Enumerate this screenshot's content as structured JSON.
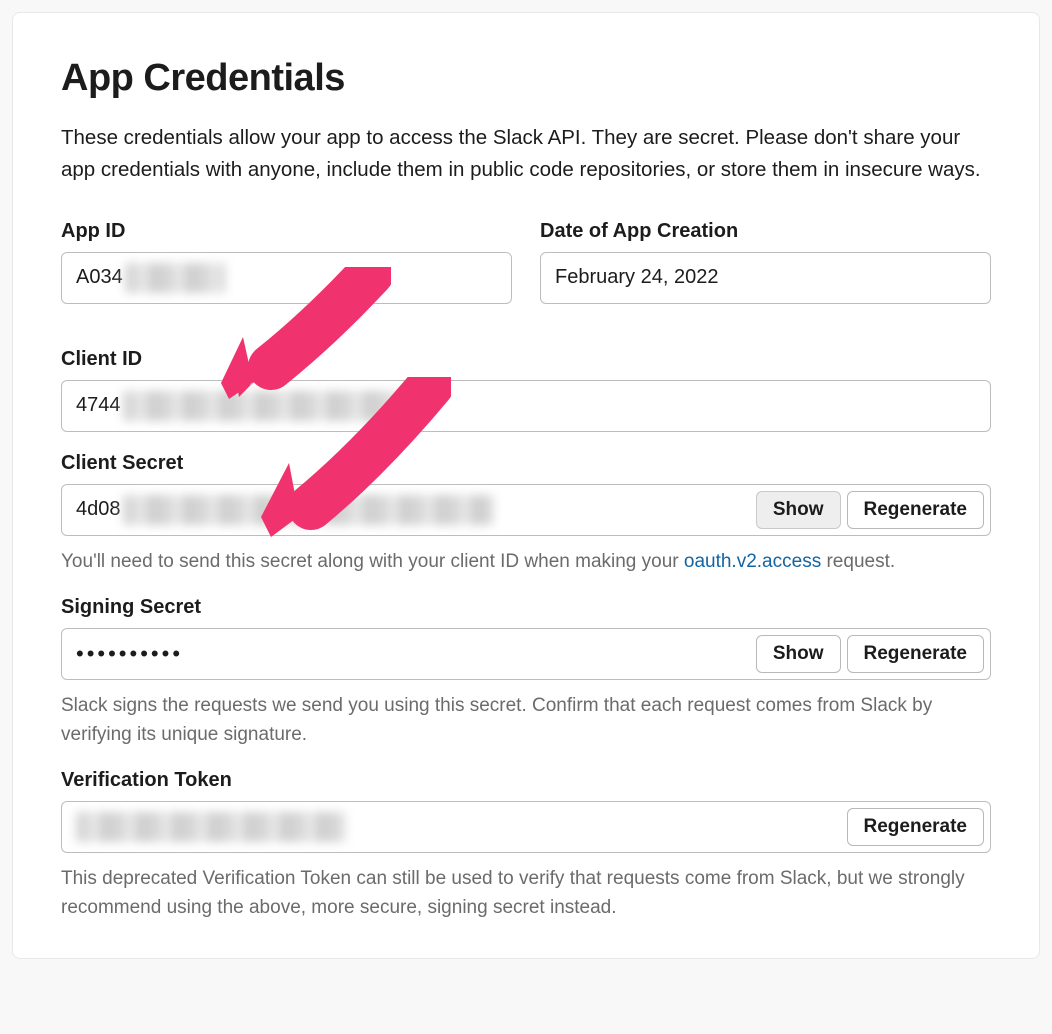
{
  "header": {
    "title": "App Credentials",
    "intro": "These credentials allow your app to access the Slack API. They are secret. Please don't share your app credentials with anyone, include them in public code repositories, or store them in insecure ways."
  },
  "fields": {
    "app_id": {
      "label": "App ID",
      "value_prefix": "A034"
    },
    "creation_date": {
      "label": "Date of App Creation",
      "value": "February 24, 2022"
    },
    "client_id": {
      "label": "Client ID",
      "value_prefix": "4744"
    },
    "client_secret": {
      "label": "Client Secret",
      "value_prefix": "4d08",
      "show_label": "Show",
      "regenerate_label": "Regenerate",
      "help_pre": "You'll need to send this secret along with your client ID when making your ",
      "help_link_text": "oauth.v2.access",
      "help_post": " request."
    },
    "signing_secret": {
      "label": "Signing Secret",
      "masked_value": "••••••••••",
      "show_label": "Show",
      "regenerate_label": "Regenerate",
      "help": "Slack signs the requests we send you using this secret. Confirm that each request comes from Slack by verifying its unique signature."
    },
    "verification_token": {
      "label": "Verification Token",
      "regenerate_label": "Regenerate",
      "help": "This deprecated Verification Token can still be used to verify that requests come from Slack, but we strongly recommend using the above, more secure, signing secret instead."
    }
  }
}
